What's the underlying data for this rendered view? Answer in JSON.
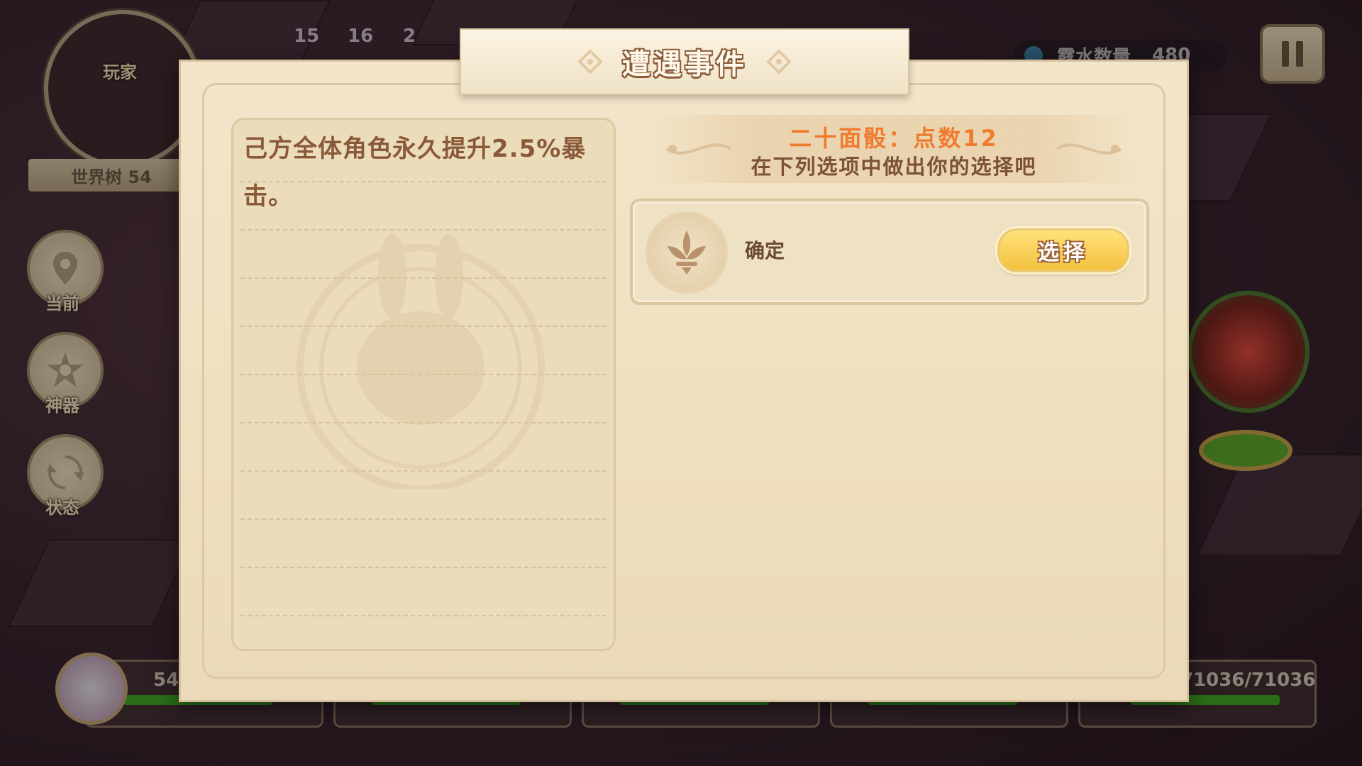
{
  "hud": {
    "minimap_label": "玩家",
    "floor_label": "世界树 54",
    "counts": [
      "15",
      "16",
      "2"
    ],
    "currency_label": "露水数量",
    "currency_value": "480"
  },
  "side_menu": [
    {
      "label": "当前",
      "icon": "location-pin-icon"
    },
    {
      "label": "神器",
      "icon": "star-emblem-icon"
    },
    {
      "label": "状态",
      "icon": "refresh-cycle-icon"
    }
  ],
  "party": {
    "first_hp_text": "54",
    "last_hp_text": "71036/71036"
  },
  "dialog": {
    "title": "遭遇事件",
    "description": "己方全体角色永久提升2.5%暴击。",
    "event_title": "二十面骰：点数12",
    "event_subtitle": "在下列选项中做出你的选择吧",
    "options": [
      {
        "label": "确定",
        "button_label": "选择",
        "icon": "fleur-emblem-icon"
      }
    ]
  },
  "colors": {
    "parchment": "#efe0c1",
    "event_title": "#f07b2e",
    "text_brown": "#8a5a38",
    "button_yellow": "#f3c13d",
    "hp_green": "#3fa827"
  }
}
